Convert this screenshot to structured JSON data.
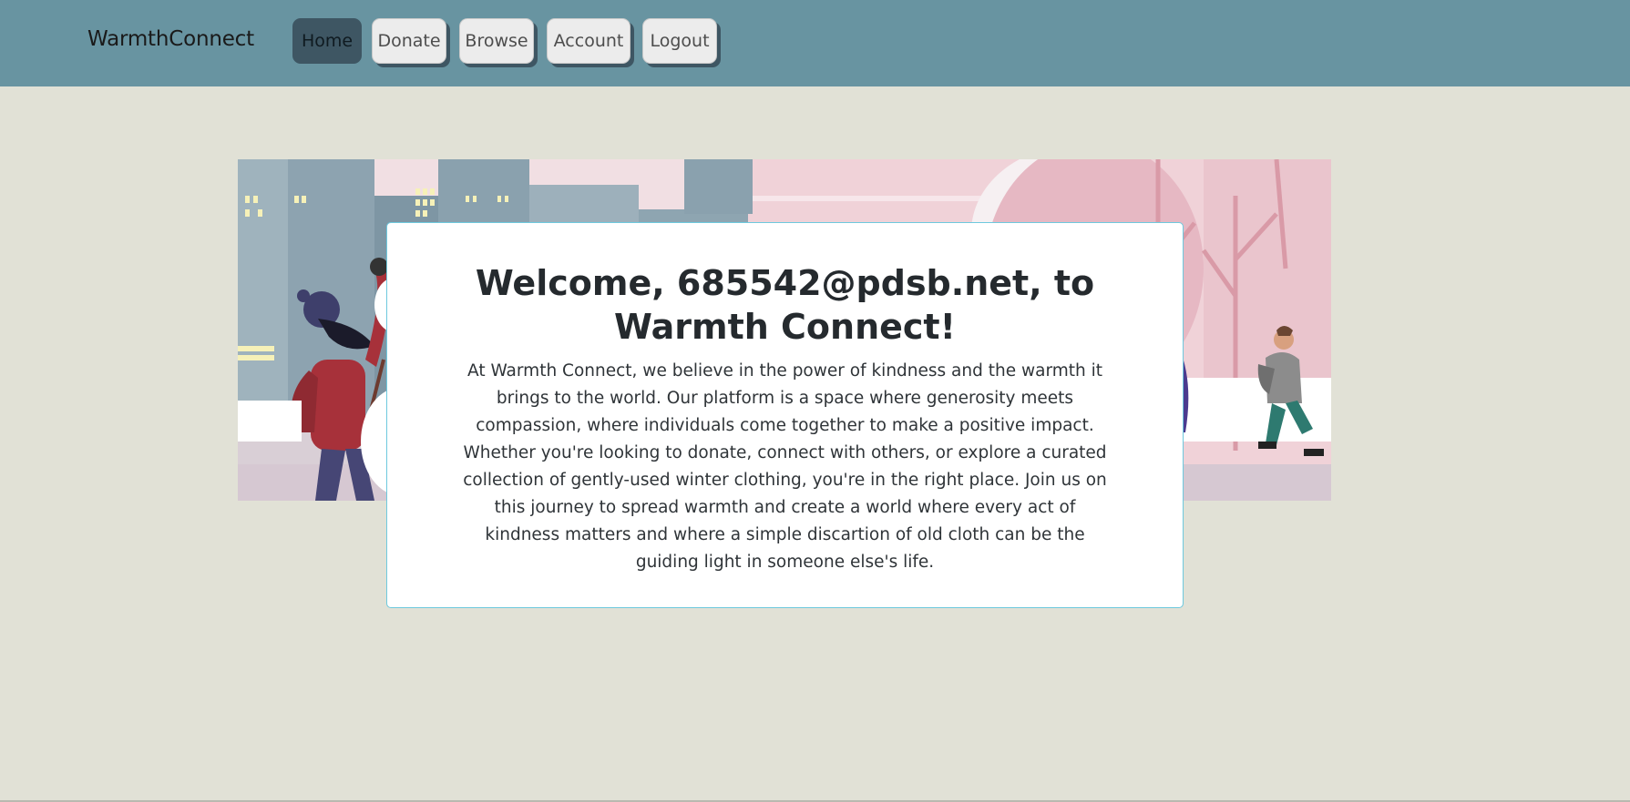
{
  "navbar": {
    "brand": "WarmthConnect",
    "items": [
      {
        "label": "Home",
        "active": true
      },
      {
        "label": "Donate",
        "active": false
      },
      {
        "label": "Browse",
        "active": false
      },
      {
        "label": "Account",
        "active": false
      },
      {
        "label": "Logout",
        "active": false
      }
    ]
  },
  "hero": {
    "image": "winter-city-illustration"
  },
  "welcome": {
    "title": "Welcome, 685542@pdsb.net, to Warmth Connect!",
    "body": "At Warmth Connect, we believe in the power of kindness and the warmth it brings to the world. Our platform is a space where generosity meets compassion, where individuals come together to make a positive impact. Whether you're looking to donate, connect with others, or explore a curated collection of gently-used winter clothing, you're in the right place. Join us on this journey to spread warmth and create a world where every act of kindness matters and where a simple discartion of old cloth can be the guiding light in someone else's life."
  },
  "colors": {
    "navbar": "#6894a1",
    "background": "#e1e1d6",
    "active_button": "#3e5663",
    "card_border": "#6ec9de"
  }
}
